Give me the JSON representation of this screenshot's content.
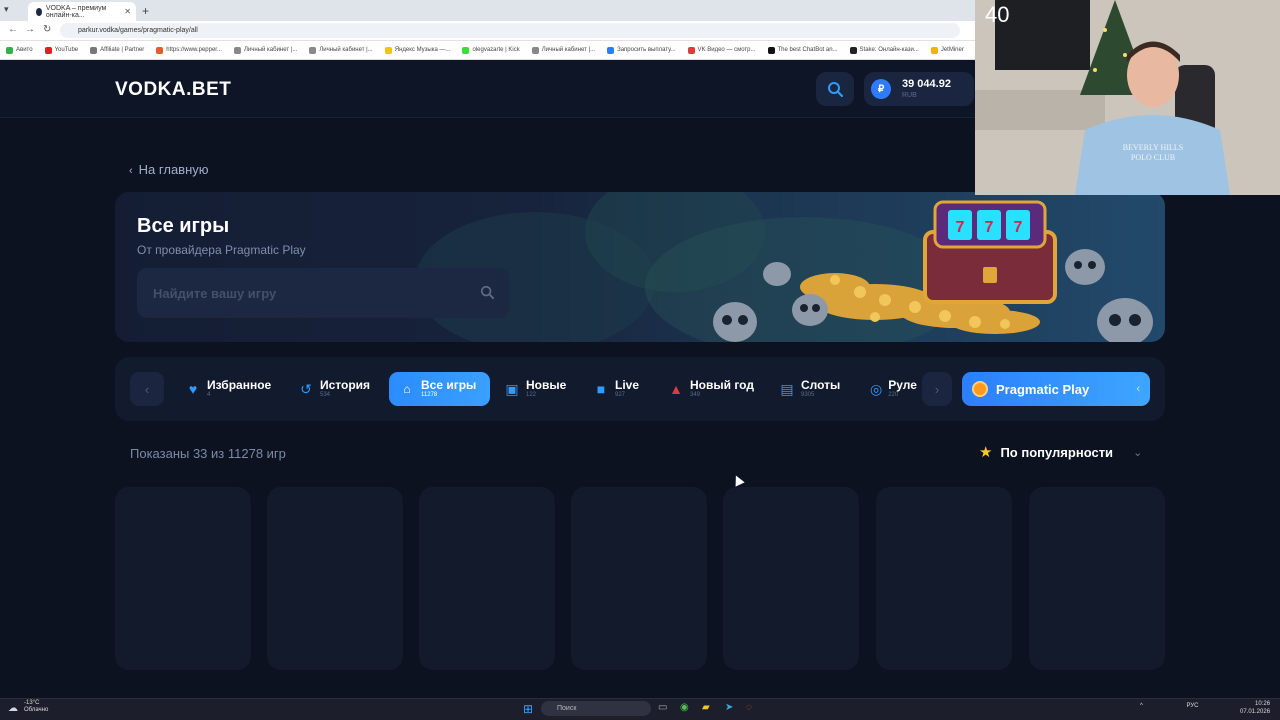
{
  "browser": {
    "tab_title": "VODKA – премиум онлайн-ка...",
    "url": "parkur.vodka/games/pragmatic-play/all",
    "bookmarks": [
      {
        "label": "Авито",
        "color": "#33b04a"
      },
      {
        "label": "YouTube",
        "color": "#e02020"
      },
      {
        "label": "Affiliate | Partner",
        "color": "#777777"
      },
      {
        "label": "https://www.pepper...",
        "color": "#e35d2b"
      },
      {
        "label": "Личный кабинет |...",
        "color": "#888888"
      },
      {
        "label": "Личный кабинет |...",
        "color": "#888888"
      },
      {
        "label": "Яндекс Музыка —...",
        "color": "#f4c400"
      },
      {
        "label": "olegvazarte | Kick",
        "color": "#3bdc3b"
      },
      {
        "label": "Личный кабинет |...",
        "color": "#888888"
      },
      {
        "label": "Запросить выплату...",
        "color": "#2f7bff"
      },
      {
        "label": "VK Видео — смотр...",
        "color": "#e03a3a"
      },
      {
        "label": "The best ChatBot an...",
        "color": "#111111"
      },
      {
        "label": "Stake: Онлайн-кази...",
        "color": "#222222"
      },
      {
        "label": "JetMiner",
        "color": "#f1b200"
      }
    ]
  },
  "header": {
    "logo": "VODKA.BET",
    "balance_amount": "39 044.92",
    "balance_currency": "RUB",
    "coin_symbol": "₽"
  },
  "webcam": {
    "counter": "40"
  },
  "page": {
    "back_label": "На главную",
    "title": "Все игры",
    "subtitle": "От провайдера Pragmatic Play",
    "search_placeholder": "Найдите вашу игру"
  },
  "categories": [
    {
      "label": "Избранное",
      "count": "4",
      "icon": "heart-icon",
      "glyph": "♥"
    },
    {
      "label": "История",
      "count": "534",
      "icon": "history-icon",
      "glyph": "↺"
    },
    {
      "label": "Все игры",
      "count": "11278",
      "icon": "gamepad-icon",
      "glyph": "🎮"
    },
    {
      "label": "Новые",
      "count": "122",
      "icon": "new-badge-icon",
      "glyph": "▣"
    },
    {
      "label": "Live",
      "count": "927",
      "icon": "camera-icon",
      "glyph": "■"
    },
    {
      "label": "Новый год",
      "count": "349",
      "icon": "santa-hat-icon",
      "glyph": "▲"
    },
    {
      "label": "Слоты",
      "count": "9305",
      "icon": "slot-machine-icon",
      "glyph": "▤"
    },
    {
      "label": "Руле",
      "count": "220",
      "icon": "roulette-icon",
      "glyph": "◎"
    }
  ],
  "provider": {
    "label": "Pragmatic Play"
  },
  "results": {
    "shown_text": "Показаны 33 из 11278 игр",
    "sort_label": "По популярности"
  },
  "taskbar": {
    "weather_temp": "-13°C",
    "weather_desc": "Облачно",
    "search_placeholder": "Поиск",
    "lang": "РУС",
    "time": "10:26",
    "date": "07.01.2026"
  },
  "colors": {
    "accent": "#2f9bff",
    "background": "#0c1220",
    "star": "#ffc928"
  }
}
